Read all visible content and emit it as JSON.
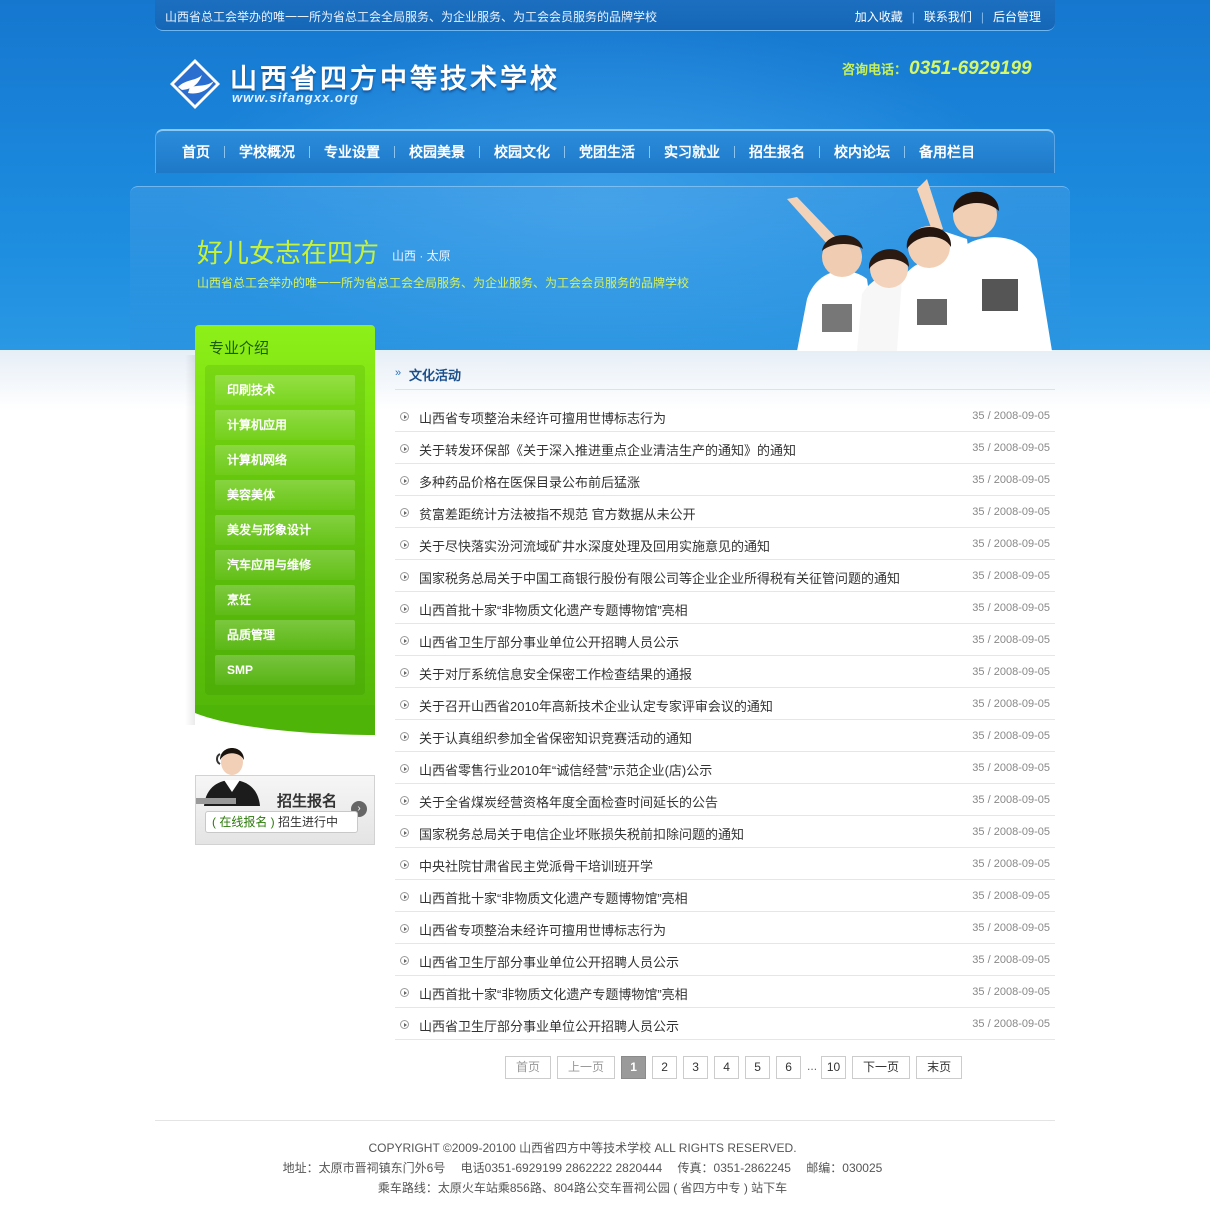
{
  "topbar": {
    "slogan": "山西省总工会举办的唯一一所为省总工会全局服务、为企业服务、为工会会员服务的品牌学校",
    "links": [
      "加入收藏",
      "联系我们",
      "后台管理"
    ]
  },
  "logo": {
    "title": "山西省四方中等技术学校",
    "url": "www.sifangxx.org"
  },
  "hotline": {
    "label": "咨询电话：",
    "number": "0351-6929199"
  },
  "nav": [
    "首页",
    "学校概况",
    "专业设置",
    "校园美景",
    "校园文化",
    "党团生活",
    "实习就业",
    "招生报名",
    "校内论坛",
    "备用栏目"
  ],
  "banner": {
    "title": "好儿女志在四方",
    "place": "山西 · 太原",
    "subtitle": "山西省总工会举办的唯一一所为省总工会全局服务、为企业服务、为工会会员服务的品牌学校"
  },
  "sidebar": {
    "title": "专业介绍",
    "items": [
      "印刷技术",
      "计算机应用",
      "计算机网络",
      "美容美体",
      "美发与形象设计",
      "汽车应用与维修",
      "烹饪",
      "品质管理",
      "SMP"
    ]
  },
  "enroll": {
    "title": "招生报名",
    "online": "( 在线报名 )",
    "status": "招生进行中"
  },
  "content": {
    "title": "文化活动",
    "news": [
      {
        "title": "山西省专项整治未经许可擅用世博标志行为",
        "views": "35",
        "date": "2008-09-05"
      },
      {
        "title": "关于转发环保部《关于深入推进重点企业清洁生产的通知》的通知",
        "views": "35",
        "date": "2008-09-05"
      },
      {
        "title": "多种药品价格在医保目录公布前后猛涨",
        "views": "35",
        "date": "2008-09-05"
      },
      {
        "title": "贫富差距统计方法被指不规范 官方数据从未公开",
        "views": "35",
        "date": "2008-09-05"
      },
      {
        "title": "关于尽快落实汾河流域矿井水深度处理及回用实施意见的通知",
        "views": "35",
        "date": "2008-09-05"
      },
      {
        "title": "国家税务总局关于中国工商银行股份有限公司等企业企业所得税有关征管问题的通知",
        "views": "35",
        "date": "2008-09-05"
      },
      {
        "title": "山西首批十家“非物质文化遗产专题博物馆”亮相",
        "views": "35",
        "date": "2008-09-05"
      },
      {
        "title": "山西省卫生厅部分事业单位公开招聘人员公示",
        "views": "35",
        "date": "2008-09-05"
      },
      {
        "title": "关于对厅系统信息安全保密工作检查结果的通报",
        "views": "35",
        "date": "2008-09-05"
      },
      {
        "title": "关于召开山西省2010年高新技术企业认定专家评审会议的通知",
        "views": "35",
        "date": "2008-09-05"
      },
      {
        "title": "关于认真组织参加全省保密知识竞赛活动的通知",
        "views": "35",
        "date": "2008-09-05"
      },
      {
        "title": "山西省零售行业2010年“诚信经营”示范企业(店)公示",
        "views": "35",
        "date": "2008-09-05"
      },
      {
        "title": "关于全省煤炭经营资格年度全面检查时间延长的公告",
        "views": "35",
        "date": "2008-09-05"
      },
      {
        "title": "国家税务总局关于电信企业坏账损失税前扣除问题的通知",
        "views": "35",
        "date": "2008-09-05"
      },
      {
        "title": "中央社院甘肃省民主党派骨干培训班开学",
        "views": "35",
        "date": "2008-09-05"
      },
      {
        "title": "山西首批十家“非物质文化遗产专题博物馆”亮相",
        "views": "35",
        "date": "2008-09-05"
      },
      {
        "title": "山西省专项整治未经许可擅用世博标志行为",
        "views": "35",
        "date": "2008-09-05"
      },
      {
        "title": "山西省卫生厅部分事业单位公开招聘人员公示",
        "views": "35",
        "date": "2008-09-05"
      },
      {
        "title": "山西首批十家“非物质文化遗产专题博物馆”亮相",
        "views": "35",
        "date": "2008-09-05"
      },
      {
        "title": "山西省卫生厅部分事业单位公开招聘人员公示",
        "views": "35",
        "date": "2008-09-05"
      }
    ]
  },
  "pager": {
    "first": "首页",
    "prev": "上一页",
    "pages": [
      "1",
      "2",
      "3",
      "4",
      "5",
      "6"
    ],
    "current": "1",
    "ellipsis": "...",
    "last_page": "10",
    "next": "下一页",
    "end": "末页"
  },
  "footer": {
    "copyright": "COPYRIGHT ©2009-20100 山西省四方中等技术学校 ALL RIGHTS RESERVED.",
    "address": "地址：太原市晋祠镇东门外6号　 电话0351-6929199 2862222 2820444　 传真：0351-2862245　 邮编：030025",
    "route": "乘车路线：太原火车站乘856路、804路公交车晋祠公园 ( 省四方中专 ) 站下车"
  },
  "colors": {
    "header_blue": "#1a86db",
    "nav_blue": "#1e79c8",
    "sidebar_green": "#6fd40e",
    "banner_title": "#c8f23a",
    "hotline": "#d6f76a",
    "content_title": "#1a4f8c"
  }
}
